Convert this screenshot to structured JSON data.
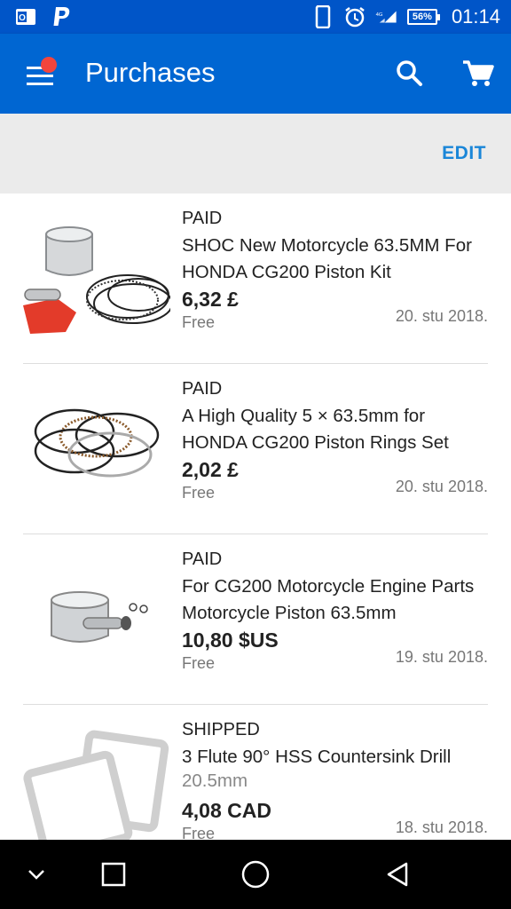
{
  "status_bar": {
    "time": "01:14",
    "battery": "56%",
    "network": "4G",
    "icons": [
      "outlook-icon",
      "paypal-icon",
      "phone-icon",
      "alarm-icon",
      "signal-icon",
      "battery-icon"
    ]
  },
  "app_bar": {
    "title": "Purchases",
    "has_notification_dot": true,
    "accent": "#0066d2"
  },
  "edit_label": "EDIT",
  "items": [
    {
      "status": "PAID",
      "name": "SHOC New Motorcycle 63.5MM For HONDA CG200 Piston Kit",
      "price": "6,32 £",
      "shipping": "Free",
      "date": "20. stu 2018."
    },
    {
      "status": "PAID",
      "name": "A High Quality 5 × 63.5mm for HONDA CG200 Piston Rings Set",
      "price": "2,02 £",
      "shipping": "Free",
      "date": "20. stu 2018."
    },
    {
      "status": "PAID",
      "name": "For CG200 Motorcycle Engine Parts Motorcycle Piston 63.5mm",
      "price": "10,80 $US",
      "shipping": "Free",
      "date": "19. stu 2018."
    },
    {
      "status": "SHIPPED",
      "name": "3 Flute 90° HSS Countersink Drill",
      "subname": "20.5mm",
      "price": "4,08 CAD",
      "shipping": "Free",
      "date": "18. stu 2018."
    }
  ],
  "nav": [
    "chevron-down-icon",
    "recents-icon",
    "home-icon",
    "back-icon"
  ]
}
